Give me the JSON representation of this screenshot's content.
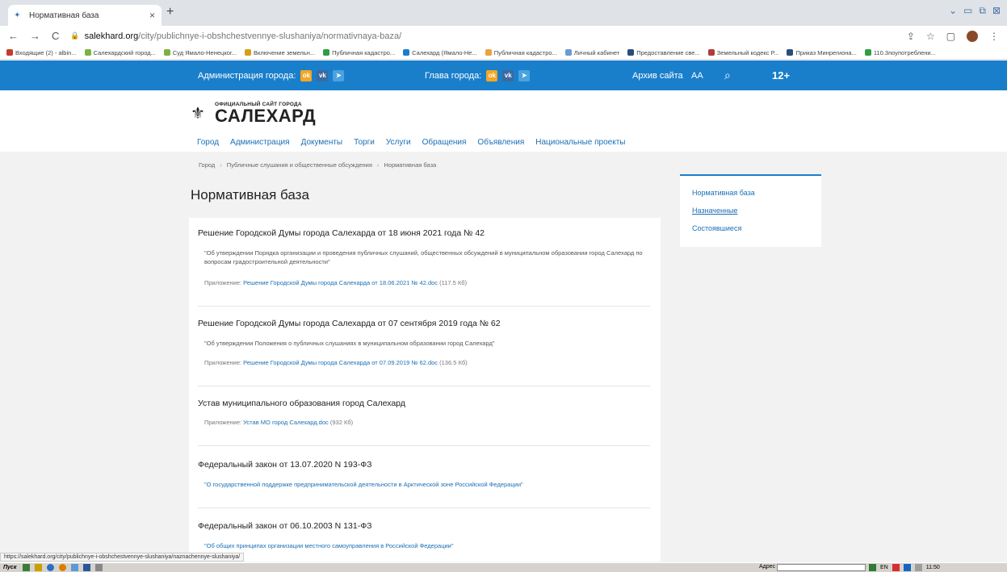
{
  "browser": {
    "tab_title": "Нормативная база",
    "url_host": "salekhard.org",
    "url_path": "/city/publichnye-i-obshchestvennye-slushaniya/normativnaya-baza/",
    "bookmarks": [
      {
        "label": "Входящие (2) - albin...",
        "color": "#c23b2b"
      },
      {
        "label": "Салехардский город...",
        "color": "#7bb241"
      },
      {
        "label": "Суд Ямало-Ненецког...",
        "color": "#7bb241"
      },
      {
        "label": "Включение земельн...",
        "color": "#d4a017"
      },
      {
        "label": "Публичная кадастро...",
        "color": "#2e9e44"
      },
      {
        "label": "Салехард (Ямало-Не...",
        "color": "#1a7fcb"
      },
      {
        "label": "Публичная кадастро...",
        "color": "#e8a33b"
      },
      {
        "label": "Личный кабинет",
        "color": "#6c9bd2"
      },
      {
        "label": "Предоставление све...",
        "color": "#2a4d7a"
      },
      {
        "label": "Земельный кодекс Р...",
        "color": "#b23a3a"
      },
      {
        "label": "Приказ Минрегиона...",
        "color": "#2a4d7a"
      },
      {
        "label": "110.3поупотреблени...",
        "color": "#2e9e44"
      }
    ]
  },
  "topbar": {
    "admin_label": "Администрация города:",
    "head_label": "Глава города:",
    "archive_label": "Архив сайта",
    "font_size_label": "AA",
    "age_label": "12+"
  },
  "site": {
    "logo_subtitle": "ОФИЦИАЛЬНЫЙ САЙТ ГОРОДА",
    "logo_title": "САЛЕХАРД",
    "nav": [
      "Город",
      "Администрация",
      "Документы",
      "Торги",
      "Услуги",
      "Обращения",
      "Объявления",
      "Национальные проекты"
    ]
  },
  "breadcrumb": [
    "Город",
    "Публичные слушания и общественные обсуждения",
    "Нормативная база"
  ],
  "page_title": "Нормативная база",
  "docs": [
    {
      "title": "Решение Городской Думы города Салехарда от 18 июня 2021 года № 42",
      "desc": "\"Об утверждении Порядка организации и проведения публичных слушаний, общественных обсуждений в муниципальном образовании город Салехард по вопросам градостроительной деятельности\"",
      "attach_label": "Приложение:",
      "attach_link": "Решение Городской Думы города Салехарда от 18.06.2021 № 42.doc",
      "attach_size": "(117.5 Кб)"
    },
    {
      "title": "Решение Городской Думы города Салехарда от 07 сентября 2019 года № 62",
      "desc": "\"Об утверждении Положения о публичных слушаниях в муниципальном образовании город Салехард\"",
      "attach_label": "Приложение:",
      "attach_link": "Решение Городской Думы города Салехарда от 07.09.2019 № 62.doc",
      "attach_size": "(136.5 Кб)"
    },
    {
      "title": "Устав муниципального образования город Салехард",
      "attach_label": "Приложение:",
      "attach_link": "Устав МО город Салехард.doc",
      "attach_size": "(932 Кб)"
    },
    {
      "title": "Федеральный закон от 13.07.2020 N 193-ФЗ",
      "link_desc": "\"О государственной поддержке предпринимательской деятельности в Арктической зоне Российской Федерации\""
    },
    {
      "title": "Федеральный закон от 06.10.2003 N 131-ФЗ",
      "link_desc": "\"Об общих принципах организации местного самоуправления в Российской Федерации\""
    }
  ],
  "sidebar": [
    "Нормативная база",
    "Назначенные",
    "Состоявшиеся"
  ],
  "status_url": "https://salekhard.org/city/publichnye-i-obshchestvennye-slushaniya/naznachennye-slushaniya/",
  "taskbar": {
    "start_label": "Пуск",
    "addr_label": "Адрес",
    "lang": "EN",
    "time": "11:50"
  }
}
